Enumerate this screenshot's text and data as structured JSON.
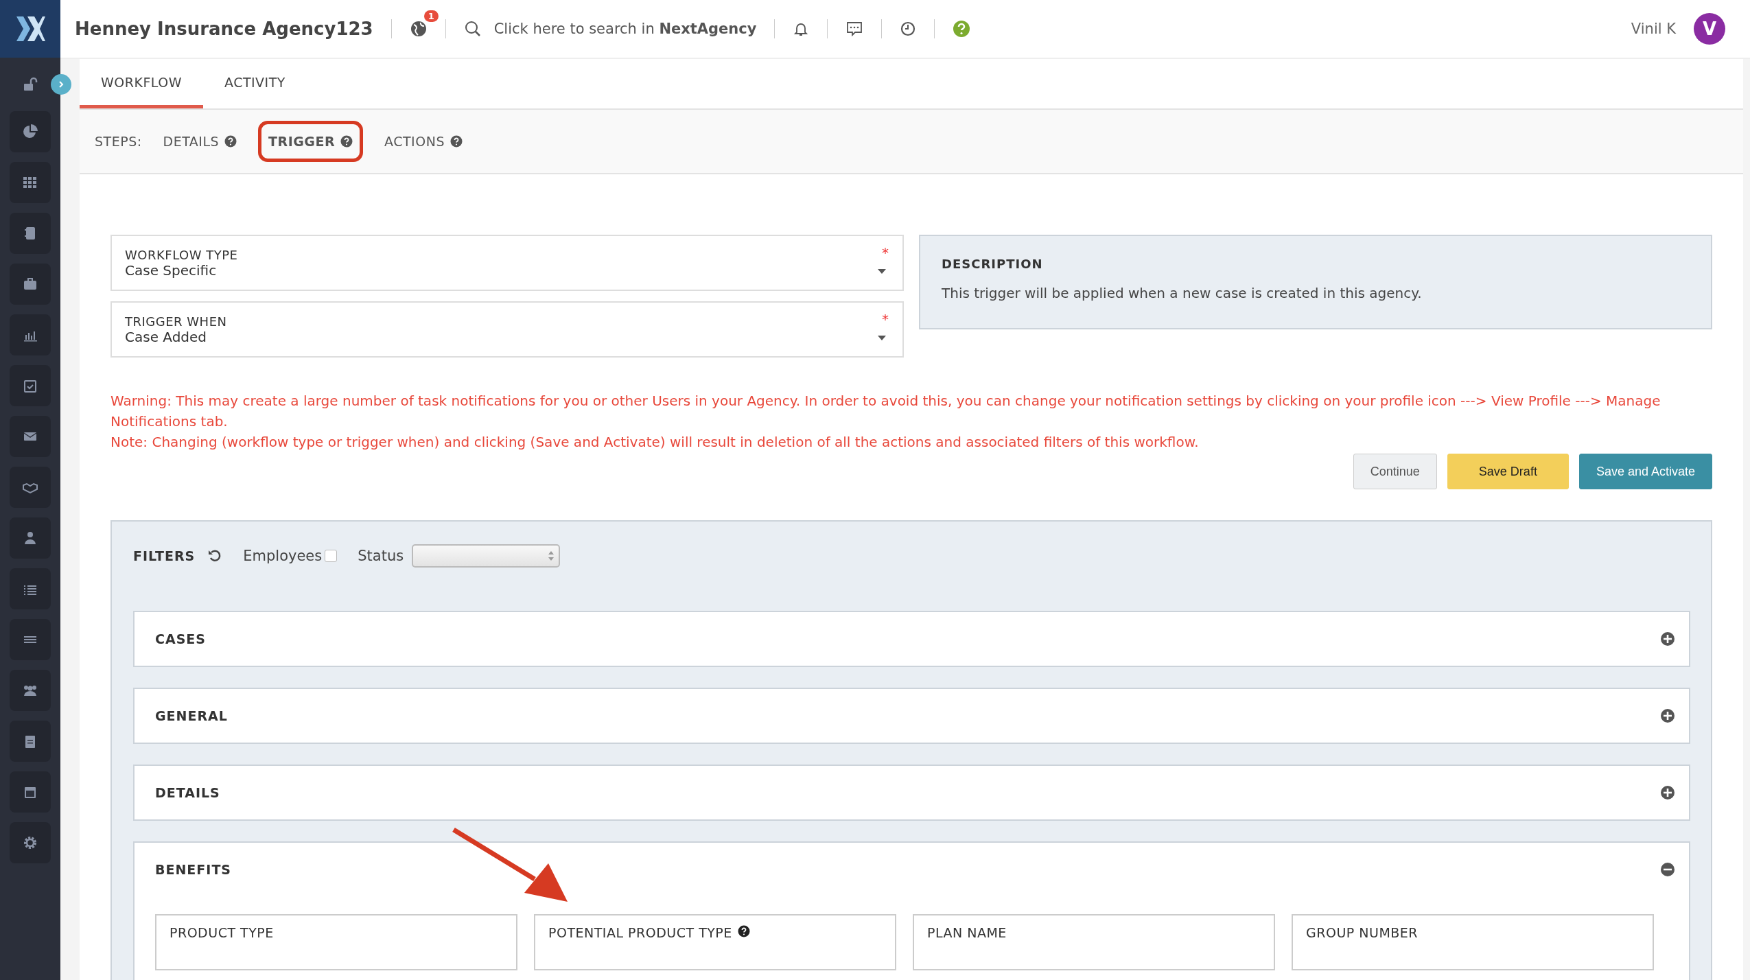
{
  "header": {
    "title": "Henney Insurance Agency123",
    "notification_badge": "1",
    "search_placeholder": "Click here to search in ",
    "search_brand": "NextAgency",
    "user_name": "Vinil K",
    "avatar_letter": "V"
  },
  "tabs": [
    {
      "label": "WORKFLOW",
      "selected": true
    },
    {
      "label": "ACTIVITY",
      "selected": false
    }
  ],
  "steps": {
    "label": "STEPS:",
    "items": [
      {
        "label": "DETAILS",
        "selected": false
      },
      {
        "label": "TRIGGER",
        "selected": true
      },
      {
        "label": "ACTIONS",
        "selected": false
      }
    ]
  },
  "fields": [
    {
      "label": "WORKFLOW TYPE",
      "value": "Case Specific",
      "required_mark": "*"
    },
    {
      "label": "TRIGGER WHEN",
      "value": "Case Added",
      "required_mark": "*"
    }
  ],
  "description": {
    "title": "DESCRIPTION",
    "text": "This trigger will be applied when a new case is created in this agency."
  },
  "warnings": [
    "Warning: This may create a large number of task notifications for you or other Users in your Agency. In order to avoid this, you can change your notification settings by clicking on your profile icon ---> View Profile ---> Manage Notifications tab.",
    "Note: Changing (workflow type or trigger when) and clicking (Save and Activate) will result in deletion of all the actions and associated filters of this workflow."
  ],
  "buttons": [
    {
      "label": "Continue",
      "kind": "plain"
    },
    {
      "label": "Save Draft",
      "kind": "draft"
    },
    {
      "label": "Save and Activate",
      "kind": "primary"
    }
  ],
  "filters": {
    "title": "FILTERS",
    "employees_label": "Employees",
    "employees_checked": false,
    "status_label": "Status",
    "sections": [
      {
        "title": "CASES",
        "expanded": false
      },
      {
        "title": "GENERAL",
        "expanded": false
      },
      {
        "title": "DETAILS",
        "expanded": false
      },
      {
        "title": "BENEFITS",
        "expanded": true,
        "fields": [
          {
            "label": "PRODUCT TYPE",
            "help": false
          },
          {
            "label": "POTENTIAL PRODUCT TYPE",
            "help": true
          },
          {
            "label": "PLAN NAME",
            "help": false
          },
          {
            "label": "GROUP NUMBER",
            "help": false
          }
        ]
      }
    ]
  }
}
